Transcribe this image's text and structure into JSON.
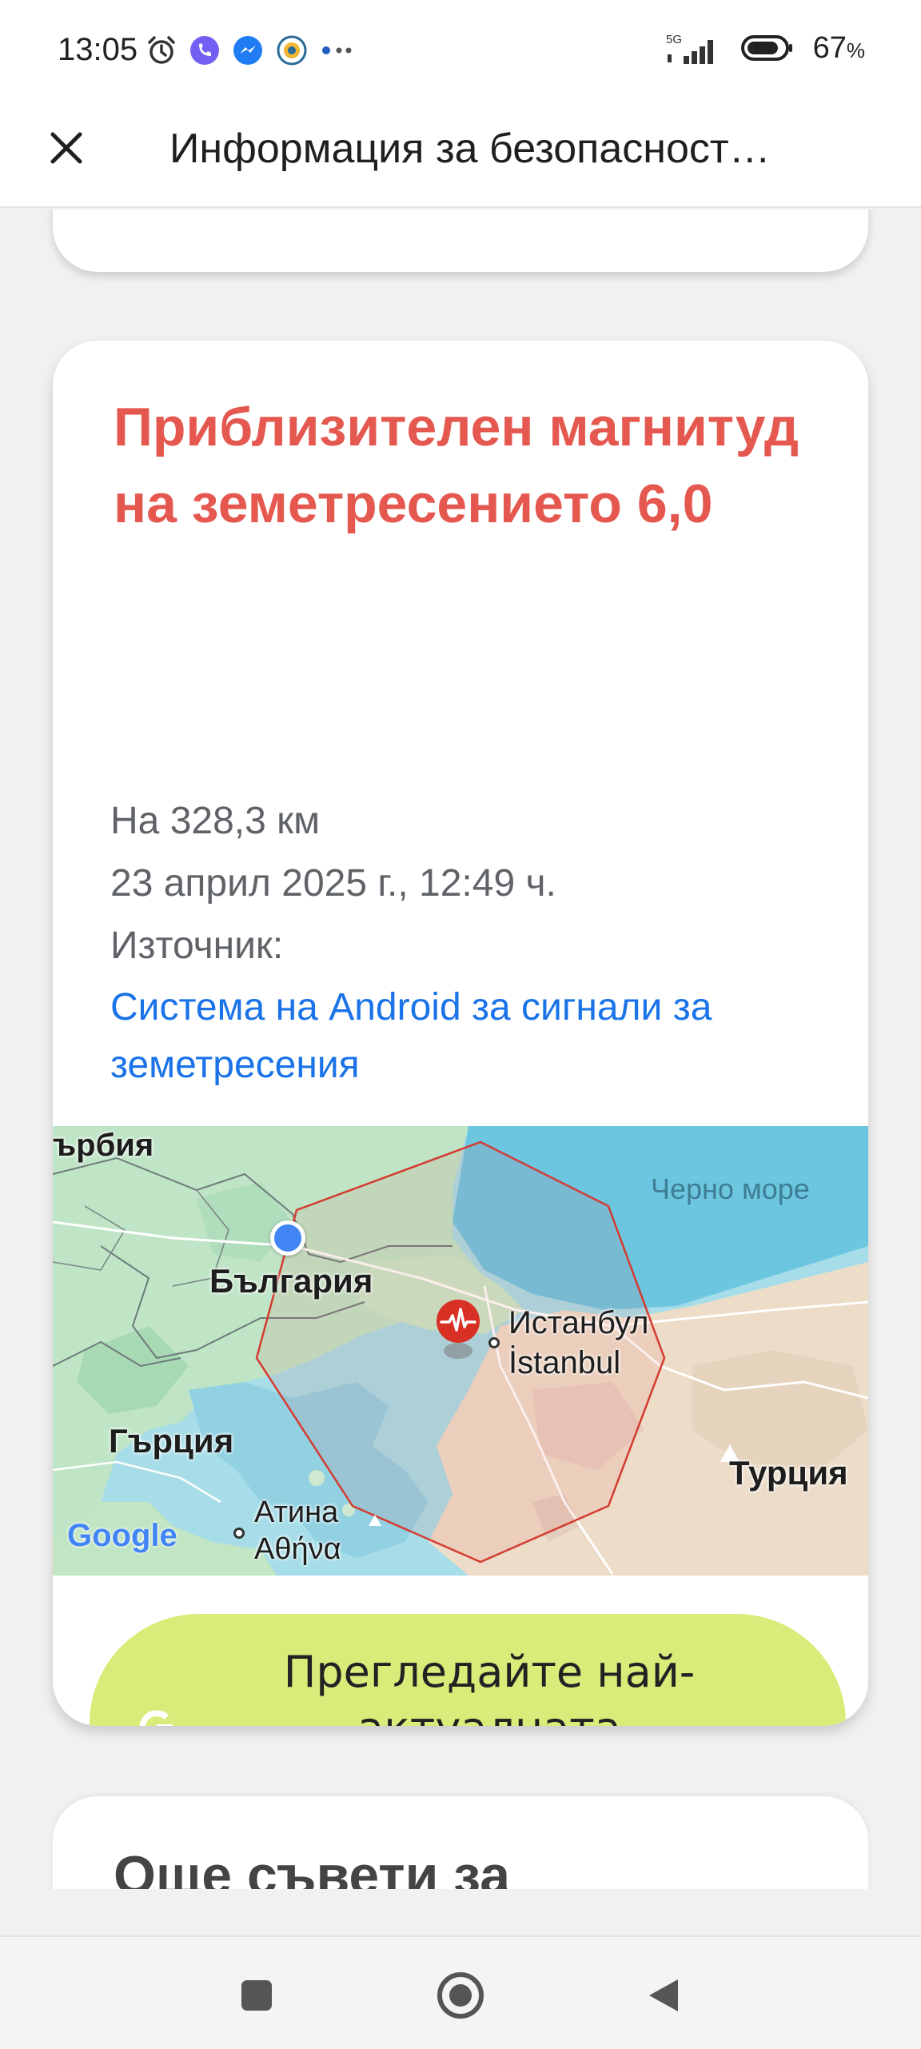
{
  "status_bar": {
    "time": "13:05",
    "battery": "67",
    "battery_unit": "%",
    "network": "5G",
    "icons": [
      "alarm-icon",
      "viber-icon",
      "messenger-icon",
      "app-badge-icon",
      "more-dots-icon"
    ]
  },
  "appbar": {
    "title": "Информация за безопасност…",
    "close_icon": "close-icon"
  },
  "card": {
    "title": "Приблизителен магнитуд на земетресението 6,0",
    "distance": "На 328,3 км",
    "datetime": "23 април 2025 г., 12:49 ч.",
    "source_label": "Източник:",
    "source_link": "Система на Android за сигнали за земетресения",
    "title_color": "#e5584f",
    "link_color": "#1a73e8"
  },
  "map": {
    "labels": {
      "serbia": "ърбия",
      "black_sea": "Черно море",
      "bulgaria": "България",
      "istanbul": "Истанбул",
      "istanbul_local": "İstanbul",
      "greece": "Гърция",
      "turkey": "Турция",
      "athens": "Атина",
      "athens_local": "Αθήνα",
      "google": "Google"
    },
    "epicenter_icon": "earthquake-marker-icon",
    "location_icon": "current-location-icon"
  },
  "cta": {
    "label": "Прегледайте най-актуалната информация",
    "icon": "google-g-icon",
    "color": "#d8ec7a"
  },
  "next_card": {
    "title": "Още съвети за"
  },
  "nav": {
    "recents": "recents-square-icon",
    "home": "home-circle-icon",
    "back": "back-triangle-icon"
  }
}
